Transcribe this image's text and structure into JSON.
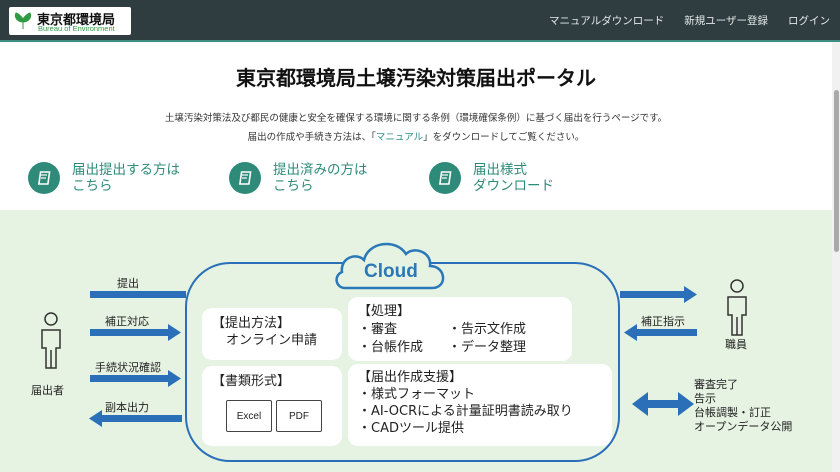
{
  "header": {
    "logo_ja": "東京都環境局",
    "logo_en": "Bureau of Environment",
    "nav": [
      "マニュアルダウンロード",
      "新規ユーザー登録",
      "ログイン"
    ]
  },
  "intro": {
    "title": "東京都環境局土壌汚染対策届出ポータル",
    "desc1": "土壌汚染対策法及び都民の健康と安全を確保する環境に関する条例（環境確保条例）に基づく届出を行うページです。",
    "desc2_before": "届出の作成や手続き方法は、「",
    "desc2_link": "マニュアル",
    "desc2_after": "」をダウンロードしてご覧ください。"
  },
  "actions": [
    {
      "label": "届出提出する方は\nこちら",
      "icon": "book-icon"
    },
    {
      "label": "提出済みの方は\nこちら",
      "icon": "book-icon"
    },
    {
      "label": "届出様式\nダウンロード",
      "icon": "book-icon"
    }
  ],
  "diagram": {
    "cloud": "Cloud",
    "applicant": "届出者",
    "staff": "職員",
    "left_flows": [
      "提出",
      "補正対応",
      "手続状況確認",
      "副本出力"
    ],
    "right_flow": "補正指示",
    "submit_method": {
      "title": "【提出方法】",
      "value": "オンライン申請"
    },
    "processing": {
      "title": "【処理】",
      "items": [
        "・審査",
        "・告示文作成",
        "・台帳作成",
        "・データ整理"
      ]
    },
    "doc_format": {
      "title": "【書類形式】",
      "files": [
        "Excel",
        "PDF"
      ]
    },
    "support": {
      "title": "【届出作成支援】",
      "items": [
        "・様式フォーマット",
        "・AI-OCRによる計量証明書読み取り",
        "・CADツール提供"
      ]
    },
    "outputs": [
      "審査完了",
      "告示",
      "台帳調製・訂正",
      "オープンデータ公開"
    ]
  },
  "colors": {
    "header_bg": "#2f3d40",
    "accent": "#2e8b7a",
    "diagram_bg": "#e6f3e2",
    "arrow_blue": "#2a6fb7",
    "cloud_blue": "#2a78b8"
  }
}
